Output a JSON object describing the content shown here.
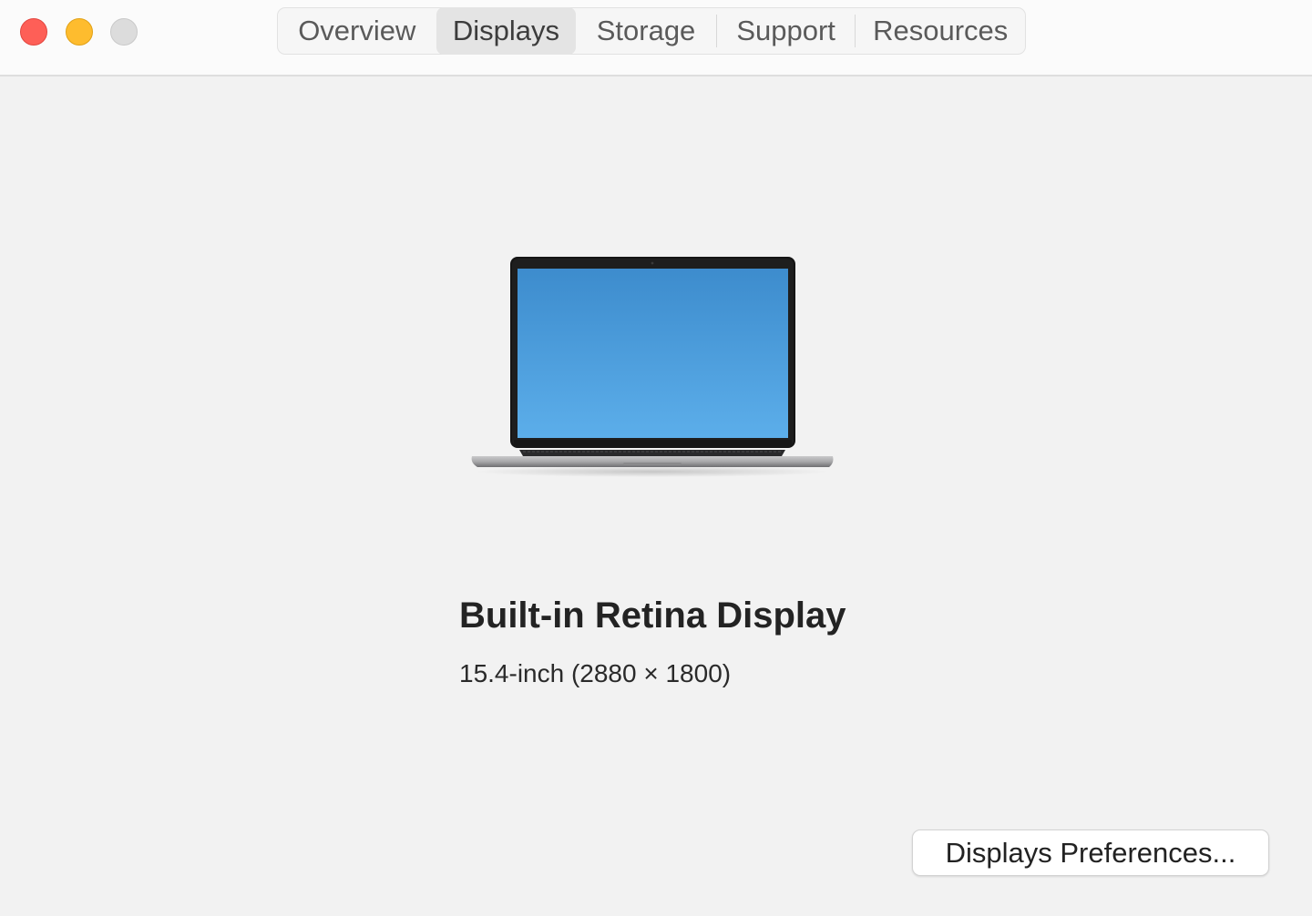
{
  "window": {
    "traffic_lights": {
      "close_color": "#fe5f57",
      "minimize_color": "#febc2e",
      "zoom_color": "#dcdcdc"
    }
  },
  "tabs": [
    {
      "label": "Overview",
      "selected": false
    },
    {
      "label": "Displays",
      "selected": true
    },
    {
      "label": "Storage",
      "selected": false
    },
    {
      "label": "Support",
      "selected": false
    },
    {
      "label": "Resources",
      "selected": false
    }
  ],
  "display": {
    "image": "macbook-laptop-illustration",
    "name": "Built-in Retina Display",
    "spec": "15.4-inch (2880 × 1800)"
  },
  "actions": {
    "preferences_label": "Displays Preferences..."
  }
}
